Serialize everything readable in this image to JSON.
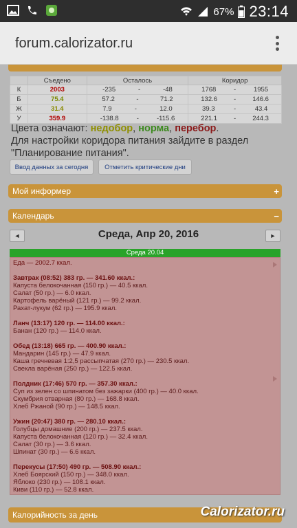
{
  "status_bar": {
    "battery_percent": "67%",
    "time": "23:14"
  },
  "browser": {
    "url": "forum.calorizator.ru"
  },
  "summary_table": {
    "headers": [
      "Съедено",
      "Осталось",
      "Коридор"
    ],
    "rows": [
      {
        "label": "К",
        "eaten": "2003",
        "rem_from": "-235",
        "rem_to": "-48",
        "cor_from": "1768",
        "cor_to": "1955",
        "eaten_color": "#b00000"
      },
      {
        "label": "Б",
        "eaten": "75.4",
        "rem_from": "57.2",
        "rem_to": "71.2",
        "cor_from": "132.6",
        "cor_to": "146.6",
        "eaten_color": "#7a8a00"
      },
      {
        "label": "Ж",
        "eaten": "31.4",
        "rem_from": "7.9",
        "rem_to": "12.0",
        "cor_from": "39.3",
        "cor_to": "43.4",
        "eaten_color": "#8a8a00"
      },
      {
        "label": "У",
        "eaten": "359.9",
        "rem_from": "-138.8",
        "rem_to": "-115.6",
        "cor_from": "221.1",
        "cor_to": "244.3",
        "eaten_color": "#b00000"
      }
    ],
    "dash": "-"
  },
  "legend": {
    "prefix": "Цвета означают: ",
    "under": "недобор",
    "sep1": ", ",
    "norm": "норма",
    "sep2": ", ",
    "over": "перебор",
    "end": ".",
    "hint": "Для настройки коридора питания зайдите в раздел \"Планирование питания\"."
  },
  "buttons": {
    "enter_today": "Ввод данных за сегодня",
    "mark_critical": "Отметить критические дни"
  },
  "informer": {
    "title": "Мой информер",
    "toggle": "+"
  },
  "calendar": {
    "title": "Календарь",
    "toggle": "−",
    "prev": "◄",
    "next": "►",
    "date": "Среда, Апр 20, 2016",
    "day_label": "Среда 20.04",
    "footer_title": "Калорийность за день"
  },
  "day": {
    "total": "Еда — 2002.7 ккал.",
    "meals": [
      {
        "header": "Завтрак (08:52) 383 гр. — 341.60 ккал.:",
        "items": [
          "Капуста белокочанная (150 гр.) — 40.5 ккал.",
          "Салат (50 гр.) — 6.0 ккал.",
          "Картофель варёный (121 гр.) — 99.2 ккал.",
          "Рахат-лукум (62 гр.) — 195.9 ккал."
        ]
      },
      {
        "header": "Ланч (13:17) 120 гр. — 114.00 ккал.:",
        "items": [
          "Банан (120 гр.) — 114.0 ккал."
        ]
      },
      {
        "header": "Обед (13:18) 665 гр. — 400.90 ккал.:",
        "items": [
          "Мандарин (145 гр.) — 47.9 ккал.",
          "Каша гречневая 1:2,5 рассыпчатая (270 гр.) — 230.5 ккал.",
          "Свекла варёная (250 гр.) — 122.5 ккал."
        ]
      },
      {
        "header": "Полдник (17:46) 570 гр. — 357.30 ккал.:",
        "items": [
          "Суп из зелен со шпинатом без зажарки (400 гр.) — 40.0 ккал.",
          "Скумбрия отварная (80 гр.) — 168.8 ккал.",
          "Хлеб Ржаной (90 гр.) — 148.5 ккал."
        ]
      },
      {
        "header": "Ужин (20:47) 380 гр. — 280.10 ккал.:",
        "items": [
          "Голубцы домашние (200 гр.) — 237.5 ккал.",
          "Капуста белокочанная (120 гр.) — 32.4 ккал.",
          "Салат (30 гр.) — 3.6 ккал.",
          "Шпинат (30 гр.) — 6.6 ккал."
        ]
      },
      {
        "header": "Перекусы (17:50) 490 гр. — 508.90 ккал.:",
        "items": [
          "Хлеб Боярский (150 гр.) — 348.0 ккал.",
          "Яблоко (230 гр.) — 108.1 ккал.",
          "Киви (110 гр.) — 52.8 ккал."
        ]
      }
    ]
  },
  "watermark": "Calorizator.ru"
}
